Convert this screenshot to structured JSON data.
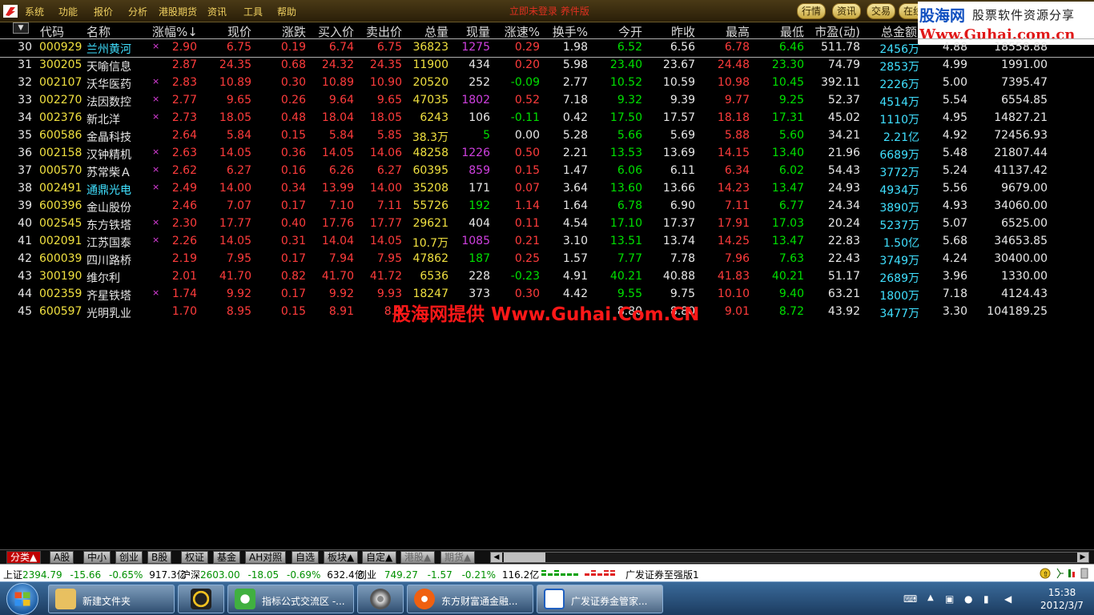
{
  "menu": {
    "items": [
      "系统",
      "功能",
      "报价",
      "分析",
      "港股期货",
      "资讯",
      "工具",
      "帮助"
    ],
    "title": "立即未登录 养件版",
    "right_buttons": [
      "行情",
      "资讯",
      "交易",
      "在线"
    ]
  },
  "watermark_top": {
    "line1": "股海网",
    "line2": "股票软件资源分享",
    "line3": "Www.Guhai.com.cn"
  },
  "table": {
    "sort_toggle": "▼",
    "headers": [
      "代码",
      "名称",
      "涨幅%↓",
      "现价",
      "涨跌",
      "买入价",
      "卖出价",
      "总量",
      "现量",
      "涨速%",
      "换手%",
      "今开",
      "昨收",
      "最高",
      "最低",
      "市盈(动)",
      "总金额"
    ],
    "rows": [
      {
        "no": "30",
        "code": "000929",
        "name": "兰州黄河",
        "name_color": "cyan",
        "mark": "×",
        "pct": "2.90",
        "price": "6.75",
        "chg": "0.19",
        "bid": "6.74",
        "ask": "6.75",
        "vol": "36823",
        "cur": "1275",
        "cur_color": "mag",
        "spd": "0.29",
        "spd_color": "red",
        "turn": "1.98",
        "open": "6.52",
        "open_color": "grn",
        "prev": "6.56",
        "high": "6.78",
        "low": "6.46",
        "pe": "511.78",
        "amt": "2456万",
        "x1": "4.88",
        "x2": "18558.88",
        "selected": true
      },
      {
        "no": "31",
        "code": "300205",
        "name": "天喻信息",
        "name_color": "white",
        "mark": "",
        "pct": "2.87",
        "price": "24.35",
        "chg": "0.68",
        "bid": "24.32",
        "ask": "24.35",
        "vol": "11900",
        "cur": "434",
        "cur_color": "wht",
        "spd": "0.20",
        "spd_color": "red",
        "turn": "5.98",
        "open": "23.40",
        "open_color": "grn",
        "prev": "23.67",
        "high": "24.48",
        "low": "23.30",
        "pe": "74.79",
        "amt": "2853万",
        "x1": "4.99",
        "x2": "1991.00"
      },
      {
        "no": "32",
        "code": "002107",
        "name": "沃华医药",
        "name_color": "white",
        "mark": "×",
        "pct": "2.83",
        "price": "10.89",
        "chg": "0.30",
        "bid": "10.89",
        "ask": "10.90",
        "vol": "20520",
        "cur": "252",
        "cur_color": "wht",
        "spd": "-0.09",
        "spd_color": "grn",
        "turn": "2.77",
        "open": "10.52",
        "open_color": "grn",
        "prev": "10.59",
        "high": "10.98",
        "low": "10.45",
        "pe": "392.11",
        "amt": "2226万",
        "x1": "5.00",
        "x2": "7395.47"
      },
      {
        "no": "33",
        "code": "002270",
        "name": "法因数控",
        "name_color": "white",
        "mark": "×",
        "pct": "2.77",
        "price": "9.65",
        "chg": "0.26",
        "bid": "9.64",
        "ask": "9.65",
        "vol": "47035",
        "cur": "1802",
        "cur_color": "mag",
        "spd": "0.52",
        "spd_color": "red",
        "turn": "7.18",
        "open": "9.32",
        "open_color": "grn",
        "prev": "9.39",
        "high": "9.77",
        "low": "9.25",
        "pe": "52.37",
        "amt": "4514万",
        "x1": "5.54",
        "x2": "6554.85"
      },
      {
        "no": "34",
        "code": "002376",
        "name": "新北洋",
        "name_color": "white",
        "mark": "×",
        "pct": "2.73",
        "price": "18.05",
        "chg": "0.48",
        "bid": "18.04",
        "ask": "18.05",
        "vol": "6243",
        "cur": "106",
        "cur_color": "wht",
        "spd": "-0.11",
        "spd_color": "grn",
        "turn": "0.42",
        "open": "17.50",
        "open_color": "grn",
        "prev": "17.57",
        "high": "18.18",
        "low": "17.31",
        "pe": "45.02",
        "amt": "1110万",
        "x1": "4.95",
        "x2": "14827.21"
      },
      {
        "no": "35",
        "code": "600586",
        "name": "金晶科技",
        "name_color": "white",
        "mark": "",
        "pct": "2.64",
        "price": "5.84",
        "chg": "0.15",
        "bid": "5.84",
        "ask": "5.85",
        "vol": "38.3万",
        "cur": "5",
        "cur_color": "grn",
        "spd": "0.00",
        "spd_color": "wht",
        "turn": "5.28",
        "open": "5.66",
        "open_color": "grn",
        "prev": "5.69",
        "high": "5.88",
        "low": "5.60",
        "pe": "34.21",
        "amt": "2.21亿",
        "x1": "4.92",
        "x2": "72456.93"
      },
      {
        "no": "36",
        "code": "002158",
        "name": "汉钟精机",
        "name_color": "white",
        "mark": "×",
        "pct": "2.63",
        "price": "14.05",
        "chg": "0.36",
        "bid": "14.05",
        "ask": "14.06",
        "vol": "48258",
        "cur": "1226",
        "cur_color": "mag",
        "spd": "0.50",
        "spd_color": "red",
        "turn": "2.21",
        "open": "13.53",
        "open_color": "grn",
        "prev": "13.69",
        "high": "14.15",
        "low": "13.40",
        "pe": "21.96",
        "amt": "6689万",
        "x1": "5.48",
        "x2": "21807.44"
      },
      {
        "no": "37",
        "code": "000570",
        "name": "苏常柴Ａ",
        "name_color": "white",
        "mark": "×",
        "pct": "2.62",
        "price": "6.27",
        "chg": "0.16",
        "bid": "6.26",
        "ask": "6.27",
        "vol": "60395",
        "cur": "859",
        "cur_color": "mag",
        "spd": "0.15",
        "spd_color": "red",
        "turn": "1.47",
        "open": "6.06",
        "open_color": "grn",
        "prev": "6.11",
        "high": "6.34",
        "low": "6.02",
        "pe": "54.43",
        "amt": "3772万",
        "x1": "5.24",
        "x2": "41137.42"
      },
      {
        "no": "38",
        "code": "002491",
        "name": "通鼎光电",
        "name_color": "cyan",
        "mark": "×",
        "pct": "2.49",
        "price": "14.00",
        "chg": "0.34",
        "bid": "13.99",
        "ask": "14.00",
        "vol": "35208",
        "cur": "171",
        "cur_color": "wht",
        "spd": "0.07",
        "spd_color": "red",
        "turn": "3.64",
        "open": "13.60",
        "open_color": "grn",
        "prev": "13.66",
        "high": "14.23",
        "low": "13.47",
        "pe": "24.93",
        "amt": "4934万",
        "x1": "5.56",
        "x2": "9679.00"
      },
      {
        "no": "39",
        "code": "600396",
        "name": "金山股份",
        "name_color": "white",
        "mark": "",
        "pct": "2.46",
        "price": "7.07",
        "chg": "0.17",
        "bid": "7.10",
        "ask": "7.11",
        "vol": "55726",
        "cur": "192",
        "cur_color": "grn",
        "spd": "1.14",
        "spd_color": "red",
        "turn": "1.64",
        "open": "6.78",
        "open_color": "grn",
        "prev": "6.90",
        "high": "7.11",
        "low": "6.77",
        "pe": "24.34",
        "amt": "3890万",
        "x1": "4.93",
        "x2": "34060.00"
      },
      {
        "no": "40",
        "code": "002545",
        "name": "东方铁塔",
        "name_color": "white",
        "mark": "×",
        "pct": "2.30",
        "price": "17.77",
        "chg": "0.40",
        "bid": "17.76",
        "ask": "17.77",
        "vol": "29621",
        "cur": "404",
        "cur_color": "wht",
        "spd": "0.11",
        "spd_color": "red",
        "turn": "4.54",
        "open": "17.10",
        "open_color": "grn",
        "prev": "17.37",
        "high": "17.91",
        "low": "17.03",
        "pe": "20.24",
        "amt": "5237万",
        "x1": "5.07",
        "x2": "6525.00"
      },
      {
        "no": "41",
        "code": "002091",
        "name": "江苏国泰",
        "name_color": "white",
        "mark": "×",
        "pct": "2.26",
        "price": "14.05",
        "chg": "0.31",
        "bid": "14.04",
        "ask": "14.05",
        "vol": "10.7万",
        "cur": "1085",
        "cur_color": "mag",
        "spd": "0.21",
        "spd_color": "red",
        "turn": "3.10",
        "open": "13.51",
        "open_color": "grn",
        "prev": "13.74",
        "high": "14.25",
        "low": "13.47",
        "pe": "22.83",
        "amt": "1.50亿",
        "x1": "5.68",
        "x2": "34653.85"
      },
      {
        "no": "42",
        "code": "600039",
        "name": "四川路桥",
        "name_color": "white",
        "mark": "",
        "pct": "2.19",
        "price": "7.95",
        "chg": "0.17",
        "bid": "7.94",
        "ask": "7.95",
        "vol": "47862",
        "cur": "187",
        "cur_color": "grn",
        "spd": "0.25",
        "spd_color": "red",
        "turn": "1.57",
        "open": "7.77",
        "open_color": "grn",
        "prev": "7.78",
        "high": "7.96",
        "low": "7.63",
        "pe": "22.43",
        "amt": "3749万",
        "x1": "4.24",
        "x2": "30400.00"
      },
      {
        "no": "43",
        "code": "300190",
        "name": "维尔利",
        "name_color": "white",
        "mark": "",
        "pct": "2.01",
        "price": "41.70",
        "chg": "0.82",
        "bid": "41.70",
        "ask": "41.72",
        "vol": "6536",
        "cur": "228",
        "cur_color": "wht",
        "spd": "-0.23",
        "spd_color": "grn",
        "turn": "4.91",
        "open": "40.21",
        "open_color": "grn",
        "prev": "40.88",
        "high": "41.83",
        "low": "40.21",
        "pe": "51.17",
        "amt": "2689万",
        "x1": "3.96",
        "x2": "1330.00"
      },
      {
        "no": "44",
        "code": "002359",
        "name": "齐星铁塔",
        "name_color": "white",
        "mark": "×",
        "pct": "1.74",
        "price": "9.92",
        "chg": "0.17",
        "bid": "9.92",
        "ask": "9.93",
        "vol": "18247",
        "cur": "373",
        "cur_color": "wht",
        "spd": "0.30",
        "spd_color": "red",
        "turn": "4.42",
        "open": "9.55",
        "open_color": "grn",
        "prev": "9.75",
        "high": "10.10",
        "low": "9.40",
        "pe": "63.21",
        "amt": "1800万",
        "x1": "7.18",
        "x2": "4124.43"
      },
      {
        "no": "45",
        "code": "600597",
        "name": "光明乳业",
        "name_color": "white",
        "mark": "",
        "pct": "1.70",
        "price": "8.95",
        "chg": "0.15",
        "bid": "8.91",
        "ask": "8.9",
        "vol": "",
        "cur": "",
        "cur_color": "wht",
        "spd": "",
        "spd_color": "red",
        "turn": "",
        "open": "8.80",
        "open_color": "wht",
        "prev": "8.80",
        "high": "9.01",
        "low": "8.72",
        "pe": "43.92",
        "amt": "3477万",
        "x1": "3.30",
        "x2": "104189.25"
      }
    ]
  },
  "banner": "股海网提供 Www.Guhai.Com.CN",
  "tabs": [
    {
      "label": "分类▲",
      "state": "active"
    },
    {
      "label": "A股",
      "state": "normal"
    },
    {
      "label": "中小",
      "state": "normal"
    },
    {
      "label": "创业",
      "state": "normal"
    },
    {
      "label": "B股",
      "state": "normal"
    },
    {
      "label": "权证",
      "state": "normal"
    },
    {
      "label": "基金",
      "state": "normal"
    },
    {
      "label": "AH对照",
      "state": "normal"
    },
    {
      "label": "自选",
      "state": "normal"
    },
    {
      "label": "板块▲",
      "state": "normal"
    },
    {
      "label": "自定▲",
      "state": "normal"
    },
    {
      "label": "港股▲",
      "state": "dim"
    },
    {
      "label": "期货▲",
      "state": "dim"
    }
  ],
  "status": {
    "sh": {
      "name": "上证",
      "val": "2394.79",
      "chg": "-15.66",
      "pct": "-0.65%",
      "amt": "917.3亿"
    },
    "hs": {
      "name": "沪深",
      "val": "2603.00",
      "chg": "-18.05",
      "pct": "-0.69%",
      "amt": "632.4亿"
    },
    "cy": {
      "name": "创业",
      "val": "749.27",
      "chg": "-1.57",
      "pct": "-0.21%",
      "amt": "116.2亿"
    },
    "broker": "广发证券至强版1"
  },
  "taskbar": {
    "items": [
      {
        "label": "新建文件夹"
      },
      {
        "label": ""
      },
      {
        "label": "指标公式交流区 -..."
      },
      {
        "label": ""
      },
      {
        "label": "东方财富通金融..."
      },
      {
        "label": "广发证券金管家..."
      }
    ],
    "time": "15:38",
    "date": "2012/3/7"
  },
  "colors": {
    "up": "#ff3c3c",
    "down": "#00e000",
    "code": "#f0e040",
    "cyan": "#40e0ff",
    "magenta": "#d040e0"
  }
}
